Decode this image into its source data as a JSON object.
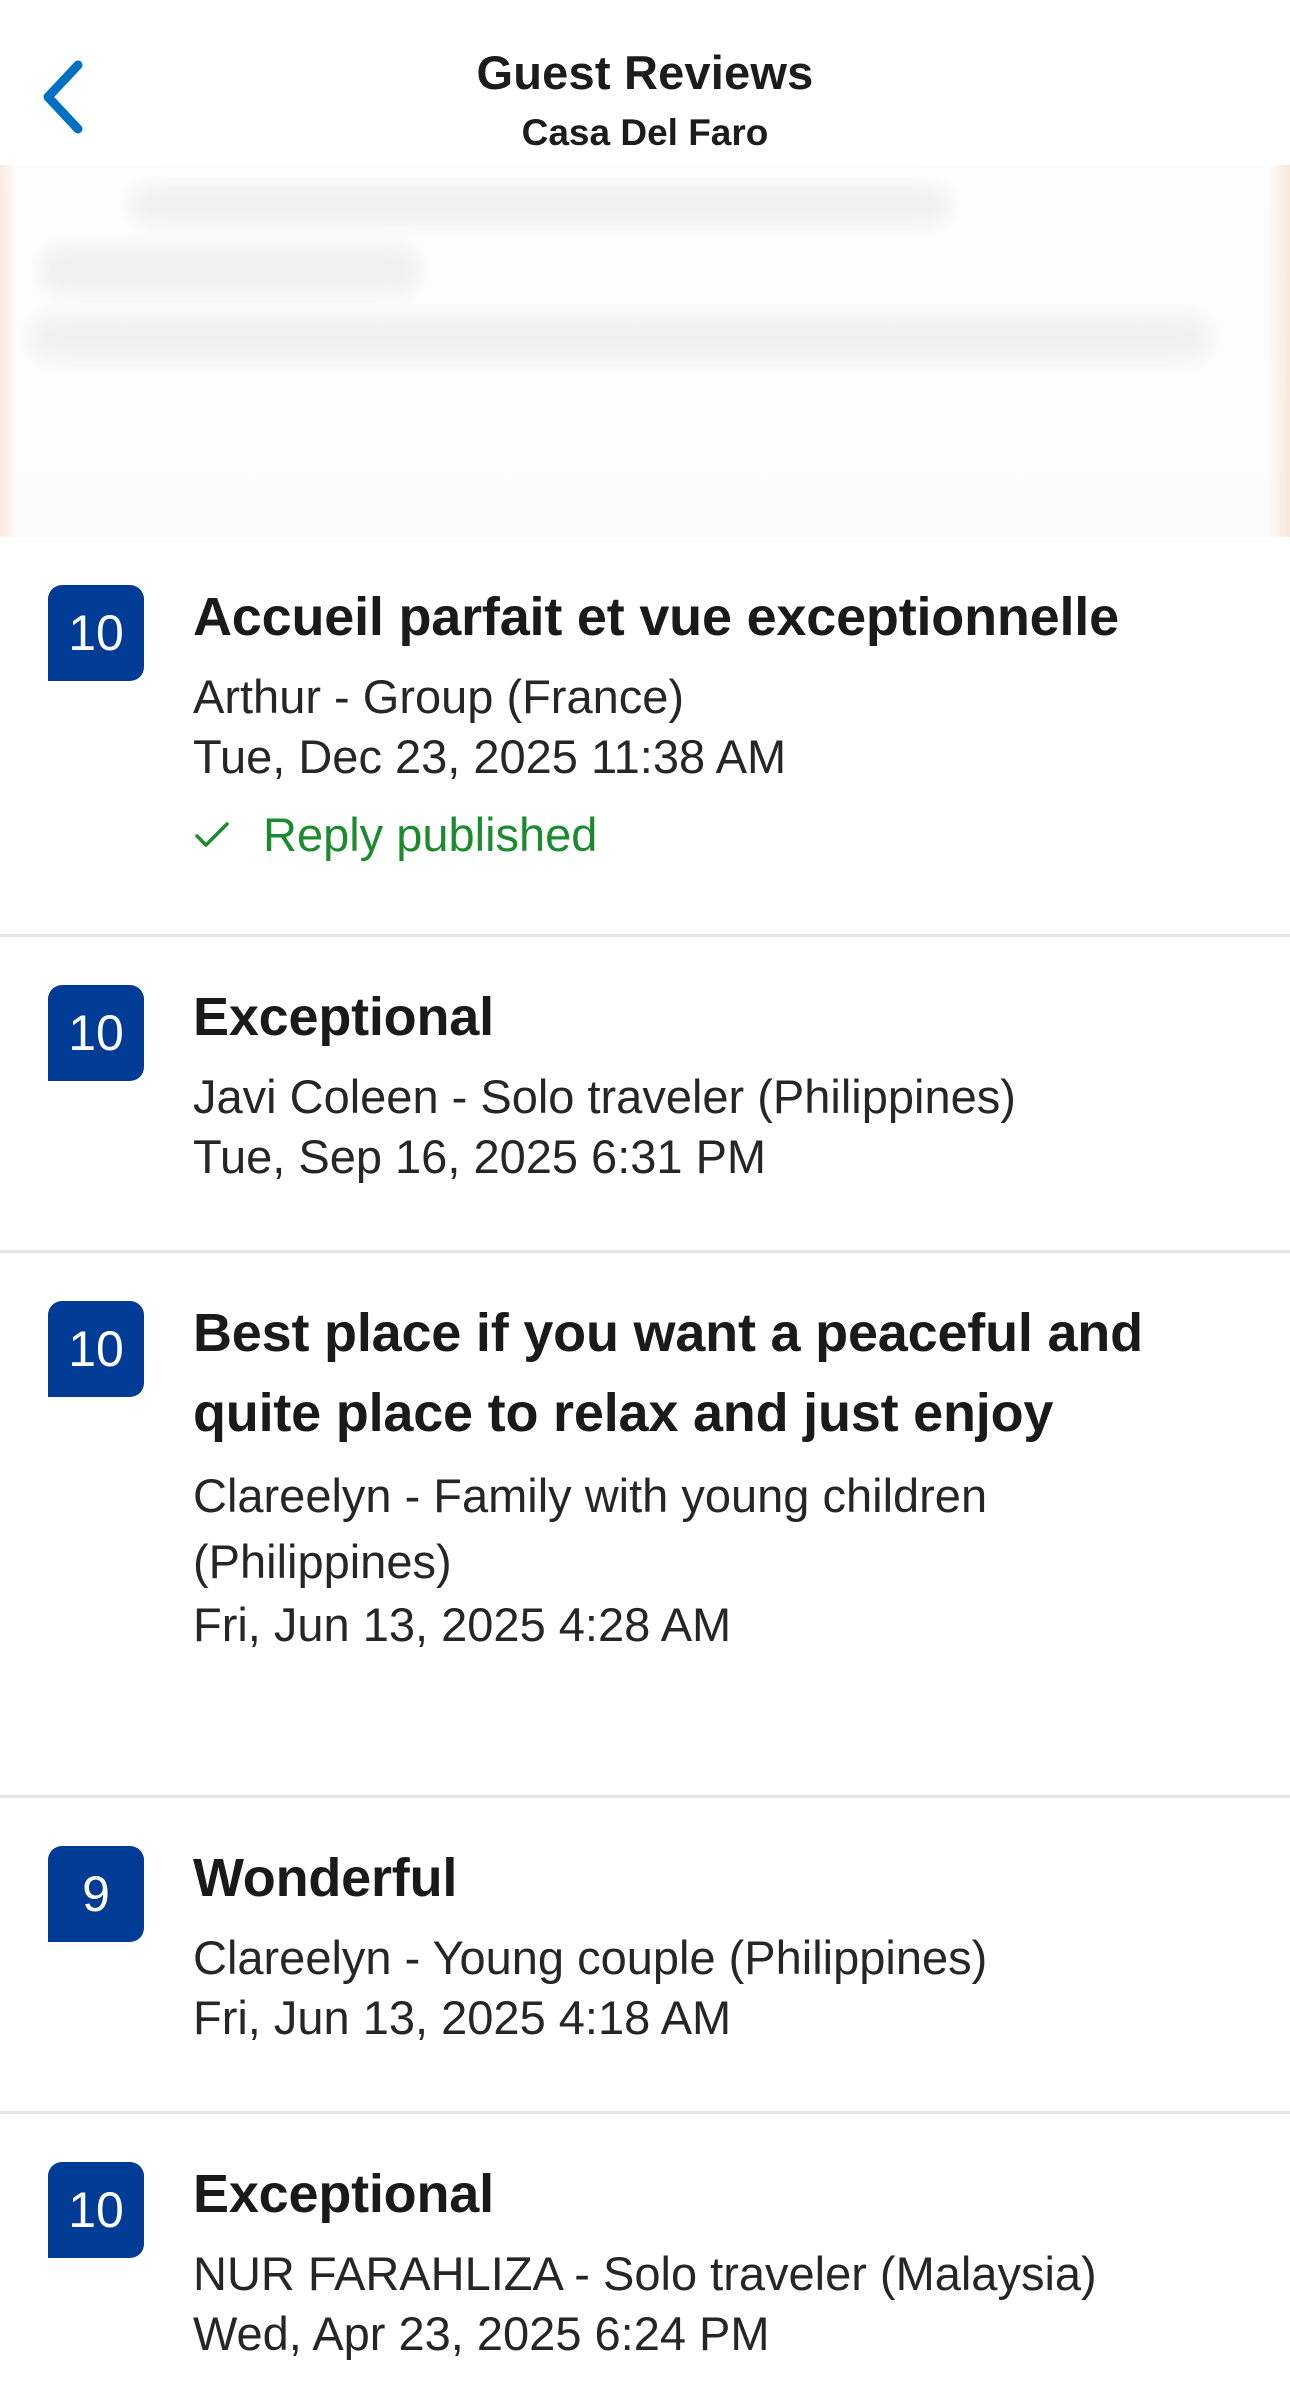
{
  "header": {
    "title": "Guest Reviews",
    "subtitle": "Casa Del Faro"
  },
  "colors": {
    "score_badge": "#003b95",
    "reply_green": "#1c8a2e",
    "back_arrow": "#0071c2"
  },
  "reviews": [
    {
      "score": "10",
      "title": "Accueil parfait et vue exceptionnelle",
      "author_line": "Arthur - Group (France)",
      "date": "Tue, Dec 23, 2025 11:38 AM",
      "reply_status": "Reply published"
    },
    {
      "score": "10",
      "title": "Exceptional",
      "author_line": "Javi Coleen - Solo traveler (Philippines)",
      "date": "Tue, Sep 16, 2025 6:31 PM"
    },
    {
      "score": "10",
      "title": "Best place if you want a peaceful and quite place to relax and just enjoy",
      "author_line": "Clareelyn - Family with young children (Philippines)",
      "date": "Fri, Jun 13, 2025 4:28 AM"
    },
    {
      "score": "9",
      "title": "Wonderful",
      "author_line": "Clareelyn - Young couple (Philippines)",
      "date": "Fri, Jun 13, 2025 4:18 AM"
    },
    {
      "score": "10",
      "title": "Exceptional",
      "author_line": "NUR FARAHLIZA - Solo traveler (Malaysia)",
      "date": "Wed, Apr 23, 2025 6:24 PM"
    }
  ]
}
